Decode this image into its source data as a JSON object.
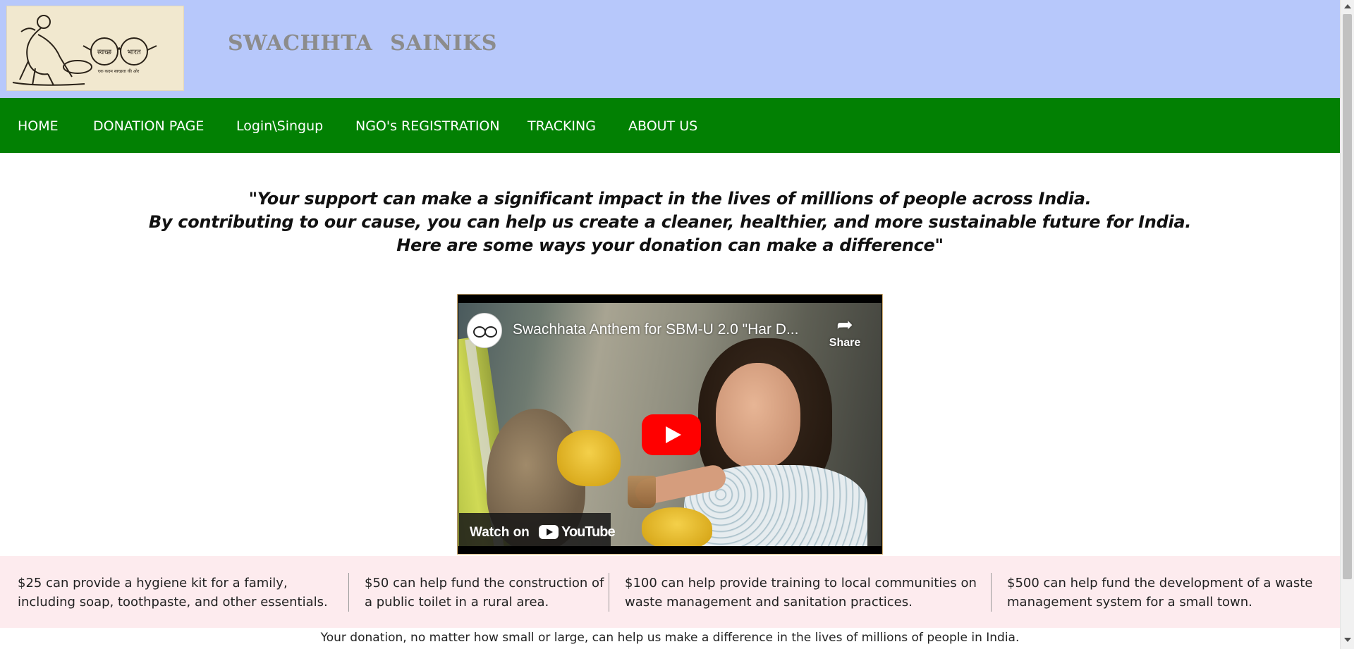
{
  "header": {
    "logo_icon": "swachh-bharat-gandhi-spectacles-logo",
    "logo_text_left": "स्वच्छ",
    "logo_text_right": "भारत",
    "logo_tagline": "एक कदम स्वच्छता की ओर",
    "title": "SWACHHTA   SAINIKS",
    "background_color": "#b7c8fb"
  },
  "nav": {
    "background_color": "#028003",
    "items": [
      {
        "label": "HOME"
      },
      {
        "label": "DONATION PAGE"
      },
      {
        "label": "Login\\Singup"
      },
      {
        "label": "NGO's REGISTRATION"
      },
      {
        "label": "TRACKING"
      },
      {
        "label": "ABOUT US"
      }
    ]
  },
  "quote": {
    "line1": "\"Your support can make a significant impact in the lives of millions of people across India.",
    "line2": "By contributing to our cause, you can help us create a cleaner, healthier, and more sustainable future for India.",
    "line3": "Here are some ways your donation can make a difference\""
  },
  "video": {
    "title": "Swachhata Anthem for SBM-U 2.0 \"Har D...",
    "share_label": "Share",
    "share_icon": "share-arrow-icon",
    "play_icon": "youtube-play-icon",
    "watch_on_label": "Watch on",
    "youtube_label": "YouTube",
    "play_button_color": "#ff0000"
  },
  "tips": {
    "background_color": "#fdebee",
    "items": [
      {
        "text": "$25 can provide a hygiene kit for a family, including soap, toothpaste, and other essentials."
      },
      {
        "text": "$50 can help fund the construction of a public toilet in a rural area."
      },
      {
        "text": "$100 can help provide training to local communities on waste management and sanitation practices."
      },
      {
        "text": "$500 can help fund the development of a waste management system for a small town."
      }
    ]
  },
  "footer": {
    "note": "Your donation, no matter how small or large, can help us make a difference in the lives of millions of people in India."
  }
}
